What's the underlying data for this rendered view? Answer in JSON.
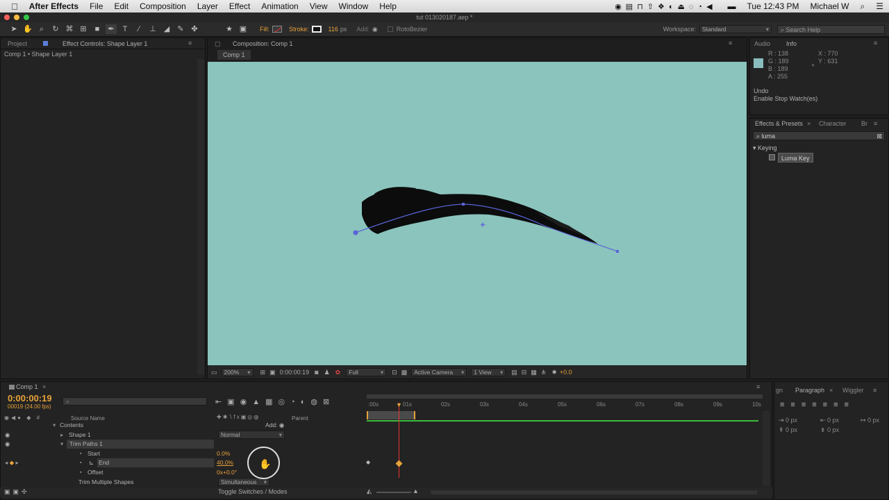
{
  "menubar": {
    "app": "After Effects",
    "items": [
      "File",
      "Edit",
      "Composition",
      "Layer",
      "Effect",
      "Animation",
      "View",
      "Window",
      "Help"
    ],
    "clock": "Tue 12:43 PM",
    "user": "Michael W"
  },
  "titlebar": {
    "title": "tut 013020187.aep *"
  },
  "toolbar": {
    "fill_label": "Fill:",
    "stroke_label": "Stroke:",
    "stroke_width": "116",
    "stroke_unit": "px",
    "add_label": "Add:",
    "rotobezier": "RotoBezier",
    "workspace_label": "Workspace:",
    "workspace_value": "Standard",
    "search_placeholder": "Search Help"
  },
  "left_panel": {
    "tab_project": "Project",
    "tab_effect_controls": "Effect Controls: Shape Layer 1",
    "breadcrumb": "Comp 1 • Shape Layer 1"
  },
  "comp_panel": {
    "tab": "Composition: Comp 1",
    "subtab": "Comp 1",
    "zoom": "200%",
    "timecode": "0:00:00:19",
    "resolution": "Full",
    "camera": "Active Camera",
    "views": "1 View",
    "exposure": "+0.0"
  },
  "info_panel": {
    "tab_audio": "Audio",
    "tab_info": "Info",
    "r": "R : 138",
    "g": "G : 189",
    "b": "B : 189",
    "a": "A : 255",
    "x": "X : 770",
    "y": "Y : 631",
    "undo_title": "Undo",
    "undo_action": "Enable Stop Watch(es)",
    "swatch_color": "#8abdbd"
  },
  "effects_panel": {
    "tab_effects": "Effects & Presets",
    "tab_character": "Character",
    "tab_extra": "Br",
    "search_value": "luma",
    "category": "Keying",
    "item": "Luma Key"
  },
  "timeline": {
    "tab": "Comp 1",
    "timecode": "0:00:00:19",
    "frames": "00019 (24.00 fps)",
    "col_source": "Source Name",
    "col_parent": "Parent",
    "ticks": [
      ":00s",
      "01s",
      "02s",
      "03s",
      "04s",
      "05s",
      "06s",
      "07s",
      "08s",
      "09s",
      "10s"
    ],
    "rows": {
      "contents": "Contents",
      "add": "Add:",
      "shape1": "Shape 1",
      "blend": "Normal",
      "trim": "Trim Paths 1",
      "start": "Start",
      "start_val": "0.0%",
      "end": "End",
      "end_val": "40.0%",
      "offset": "Offset",
      "offset_val": "0x+0.0°",
      "trim_multiple": "Trim Multiple Shapes",
      "trim_multiple_val": "Simultaneous"
    },
    "toggle": "Toggle Switches / Modes"
  },
  "paragraph_panel": {
    "tab_align": "gn",
    "tab_paragraph": "Paragraph",
    "tab_wiggler": "Wiggler",
    "px_values": [
      "0 px",
      "0 px",
      "0 px",
      "0 px",
      "0 px"
    ]
  }
}
